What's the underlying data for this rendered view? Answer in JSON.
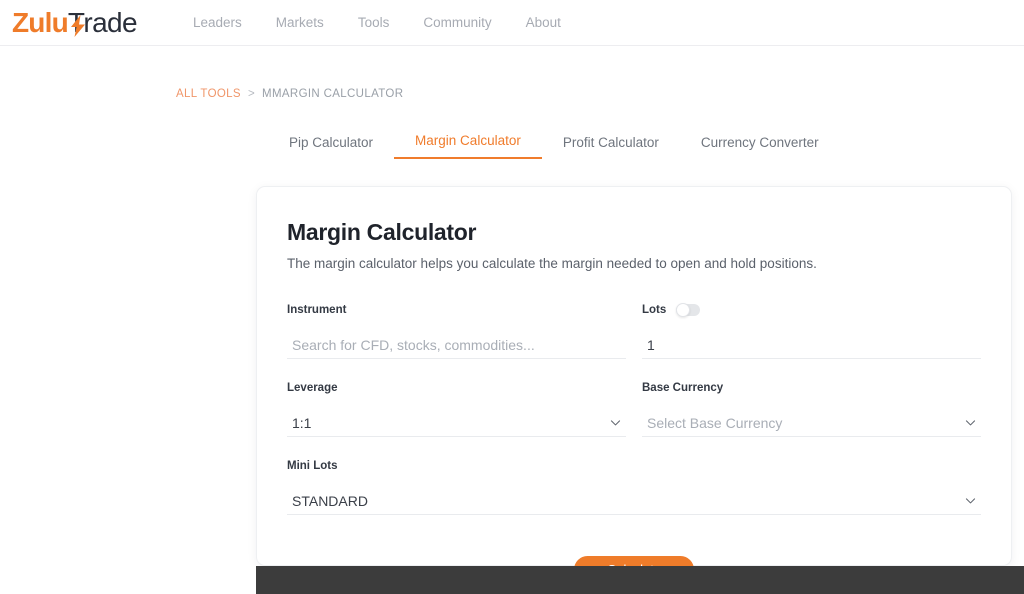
{
  "header": {
    "logo": {
      "part1": "Zulu",
      "part2": "Trade"
    },
    "nav": [
      {
        "label": "Leaders"
      },
      {
        "label": "Markets"
      },
      {
        "label": "Tools"
      },
      {
        "label": "Community"
      },
      {
        "label": "About"
      }
    ]
  },
  "breadcrumb": {
    "root": "ALL TOOLS",
    "separator": ">",
    "current": "MMARGIN CALCULATOR"
  },
  "tabs": [
    {
      "label": "Pip Calculator",
      "active": false
    },
    {
      "label": "Margin Calculator",
      "active": true
    },
    {
      "label": "Profit Calculator",
      "active": false
    },
    {
      "label": "Currency Converter",
      "active": false
    }
  ],
  "card": {
    "title": "Margin Calculator",
    "description": "The margin calculator helps you calculate the margin needed to open and hold positions."
  },
  "form": {
    "instrument": {
      "label": "Instrument",
      "value": "",
      "placeholder": "Search for CFD, stocks, commodities..."
    },
    "lots": {
      "label": "Lots",
      "value": "1",
      "toggle_state": "off"
    },
    "leverage": {
      "label": "Leverage",
      "value": "1:1"
    },
    "base_currency": {
      "label": "Base Currency",
      "placeholder": "Select Base Currency"
    },
    "mini_lots": {
      "label": "Mini Lots",
      "value": "STANDARD"
    },
    "submit_label": "Calculate"
  },
  "colors": {
    "brand_orange": "#ef7c2a",
    "logo_dark": "#2a2f3a",
    "breadcrumb_link": "#f0966a",
    "footer_dark": "#3c3c3c"
  }
}
